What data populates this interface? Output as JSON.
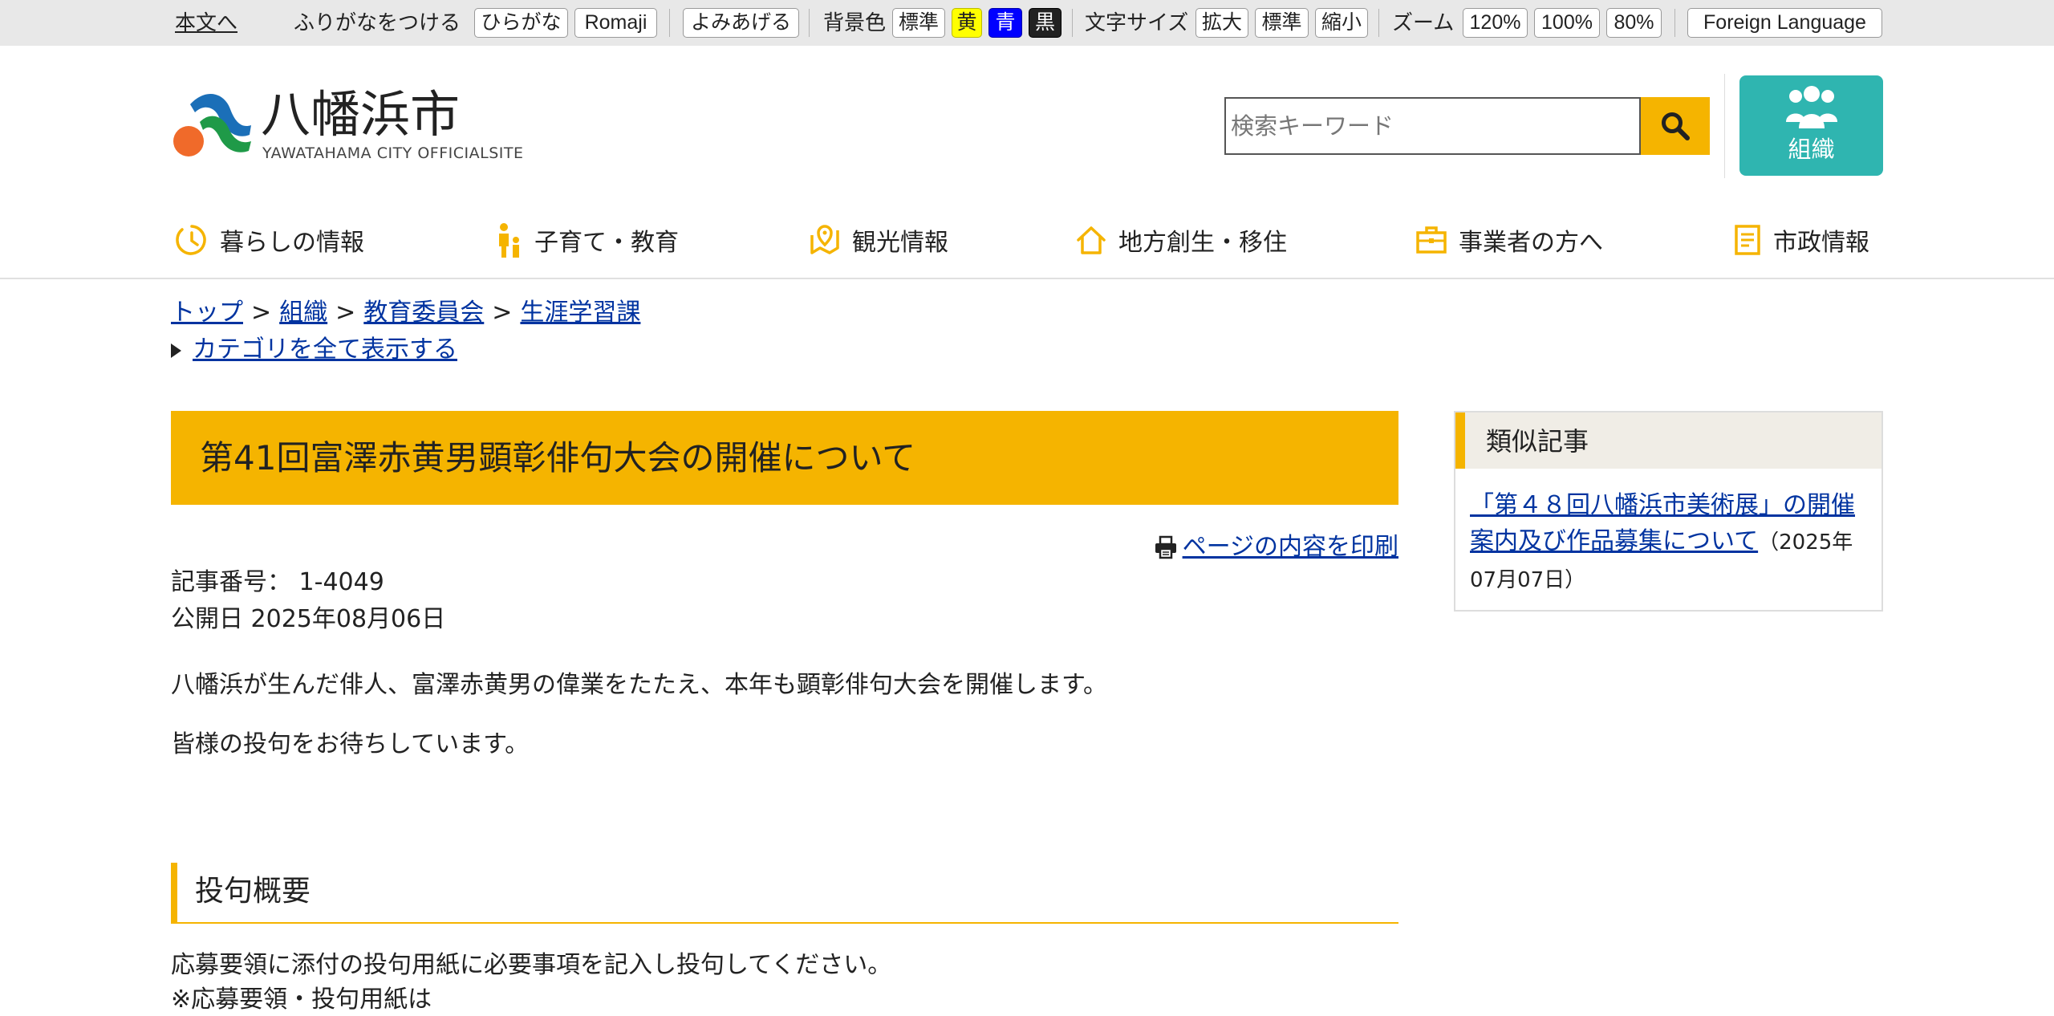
{
  "utility": {
    "skip": "本文へ",
    "furigana_label": "ふりがなをつける",
    "hiragana": "ひらがな",
    "romaji": "Romaji",
    "read_aloud": "よみあげる",
    "bg_label": "背景色",
    "bg_standard": "標準",
    "bg_yellow": "黄",
    "bg_blue": "青",
    "bg_black": "黒",
    "text_size_label": "文字サイズ",
    "text_enlarge": "拡大",
    "text_standard": "標準",
    "text_shrink": "縮小",
    "zoom_label": "ズーム",
    "zoom_120": "120%",
    "zoom_100": "100%",
    "zoom_80": "80%",
    "foreign_language": "Foreign Language"
  },
  "header": {
    "logo_title": "八幡浜市",
    "logo_subtitle": "YAWATAHAMA CITY OFFICIALSITE",
    "search_placeholder": "検索キーワード",
    "org_label": "組織"
  },
  "colors": {
    "accent": "#f5b400",
    "teal": "#2fb5b0",
    "link": "#0033a0"
  },
  "nav": {
    "items": [
      {
        "label": "暮らしの情報",
        "icon": "clock-icon"
      },
      {
        "label": "子育て・教育",
        "icon": "child-icon"
      },
      {
        "label": "観光情報",
        "icon": "map-pin-icon"
      },
      {
        "label": "地方創生・移住",
        "icon": "house-icon"
      },
      {
        "label": "事業者の方へ",
        "icon": "briefcase-icon"
      },
      {
        "label": "市政情報",
        "icon": "document-icon"
      }
    ]
  },
  "breadcrumb": {
    "items": [
      "トップ",
      "組織",
      "教育委員会",
      "生涯学習課"
    ],
    "separator": ">",
    "show_all_categories": "カテゴリを全て表示する"
  },
  "article": {
    "title": "第41回富澤赤黄男顕彰俳句大会の開催について",
    "print_link": "ページの内容を印刷",
    "article_number": "記事番号： 1-4049",
    "published": "公開日 2025年08月06日",
    "paragraphs": [
      "八幡浜が生んだ俳人、富澤赤黄男の偉業をたたえ、本年も顕彰俳句大会を開催します。",
      "皆様の投句をお待ちしています。"
    ],
    "section_heading": "投句概要",
    "section_text": "応募要領に添付の投句用紙に必要事項を記入し投句してください。",
    "clipped_text": "※応募要領・投句用紙は"
  },
  "sidebar": {
    "heading": "類似記事",
    "related": [
      {
        "title": "「第４８回八幡浜市美術展」の開催案内及び作品募集について",
        "date": "（2025年07月07日）"
      }
    ]
  }
}
